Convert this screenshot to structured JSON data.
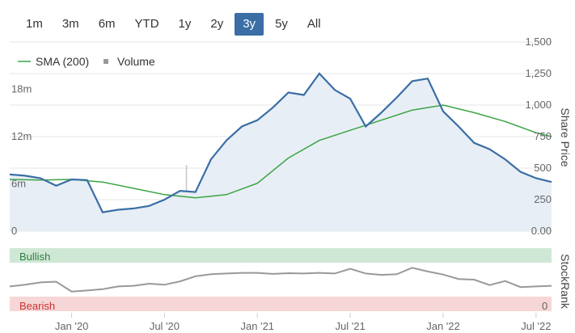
{
  "range_tabs": [
    "1m",
    "3m",
    "6m",
    "YTD",
    "1y",
    "2y",
    "3y",
    "5y",
    "All"
  ],
  "active_tab": "3y",
  "colors": {
    "price": "#3a6ea5",
    "sma": "#3aa544",
    "volume": "#c8c8c8",
    "stockrank": "#999999",
    "bullish_band": "#cfe8d6",
    "bearish_band": "#f6d6d6",
    "bullish_text": "#2f7d3c",
    "bearish_text": "#cc3333",
    "grid": "#e6e6e6"
  },
  "chart_data": [
    {
      "type": "line",
      "title": "",
      "legend": {
        "placement": "top-left",
        "items": [
          "SMA (200)",
          "Volume"
        ]
      },
      "right_axis_label": "Share Price",
      "x_ticks": [
        "Jan '20",
        "Jul '20",
        "Jan '21",
        "Jul '21",
        "Jan '22",
        "Jul '22"
      ],
      "price_ticks": [
        "1,500",
        "1,250",
        "1,000",
        "750",
        "500",
        "250",
        "0.00"
      ],
      "volume_ticks": [
        "18m",
        "12m",
        "6m",
        "0"
      ],
      "price_ylim": [
        0,
        1500
      ],
      "volume_ylim": [
        0,
        24
      ],
      "x_range": [
        "2019-09",
        "2022-08"
      ],
      "series": [
        {
          "name": "Share Price",
          "x": [
            "2019-09",
            "2019-10",
            "2019-11",
            "2019-12",
            "2020-01",
            "2020-02",
            "2020-03",
            "2020-04",
            "2020-05",
            "2020-06",
            "2020-07",
            "2020-08",
            "2020-09",
            "2020-10",
            "2020-11",
            "2020-12",
            "2021-01",
            "2021-02",
            "2021-03",
            "2021-04",
            "2021-05",
            "2021-06",
            "2021-07",
            "2021-08",
            "2021-09",
            "2021-10",
            "2021-11",
            "2021-12",
            "2022-01",
            "2022-02",
            "2022-03",
            "2022-04",
            "2022-05",
            "2022-06",
            "2022-07",
            "2022-08"
          ],
          "values": [
            450,
            440,
            420,
            360,
            410,
            405,
            150,
            170,
            180,
            200,
            250,
            320,
            310,
            570,
            720,
            830,
            880,
            980,
            1100,
            1080,
            1250,
            1120,
            1050,
            830,
            940,
            1060,
            1190,
            1210,
            950,
            830,
            700,
            650,
            570,
            470,
            420,
            390
          ]
        },
        {
          "name": "SMA (200)",
          "x": [
            "2019-09",
            "2019-11",
            "2020-01",
            "2020-03",
            "2020-05",
            "2020-07",
            "2020-09",
            "2020-11",
            "2021-01",
            "2021-03",
            "2021-05",
            "2021-07",
            "2021-09",
            "2021-11",
            "2022-01",
            "2022-03",
            "2022-05",
            "2022-07",
            "2022-08"
          ],
          "values": [
            410,
            405,
            410,
            390,
            340,
            290,
            265,
            290,
            380,
            580,
            720,
            800,
            880,
            960,
            1000,
            940,
            870,
            780,
            750
          ]
        }
      ]
    },
    {
      "type": "line",
      "title": "",
      "right_axis_label": "StockRank",
      "bands": {
        "top": "Bullish",
        "bottom": "Bearish"
      },
      "ticks": [
        "0"
      ],
      "ylim": [
        0,
        100
      ],
      "series": [
        {
          "name": "StockRank",
          "x": [
            "2019-09",
            "2019-10",
            "2019-11",
            "2019-12",
            "2020-01",
            "2020-02",
            "2020-03",
            "2020-04",
            "2020-05",
            "2020-06",
            "2020-07",
            "2020-08",
            "2020-09",
            "2020-10",
            "2020-11",
            "2020-12",
            "2021-01",
            "2021-02",
            "2021-03",
            "2021-04",
            "2021-05",
            "2021-06",
            "2021-07",
            "2021-08",
            "2021-09",
            "2021-10",
            "2021-11",
            "2021-12",
            "2022-01",
            "2022-02",
            "2022-03",
            "2022-04",
            "2022-05",
            "2022-06",
            "2022-07",
            "2022-08"
          ],
          "values": [
            30,
            35,
            42,
            44,
            15,
            18,
            22,
            30,
            32,
            38,
            35,
            45,
            60,
            66,
            68,
            70,
            70,
            67,
            69,
            68,
            70,
            68,
            82,
            68,
            64,
            66,
            85,
            74,
            65,
            52,
            50,
            34,
            46,
            28,
            30,
            32
          ]
        }
      ]
    }
  ]
}
